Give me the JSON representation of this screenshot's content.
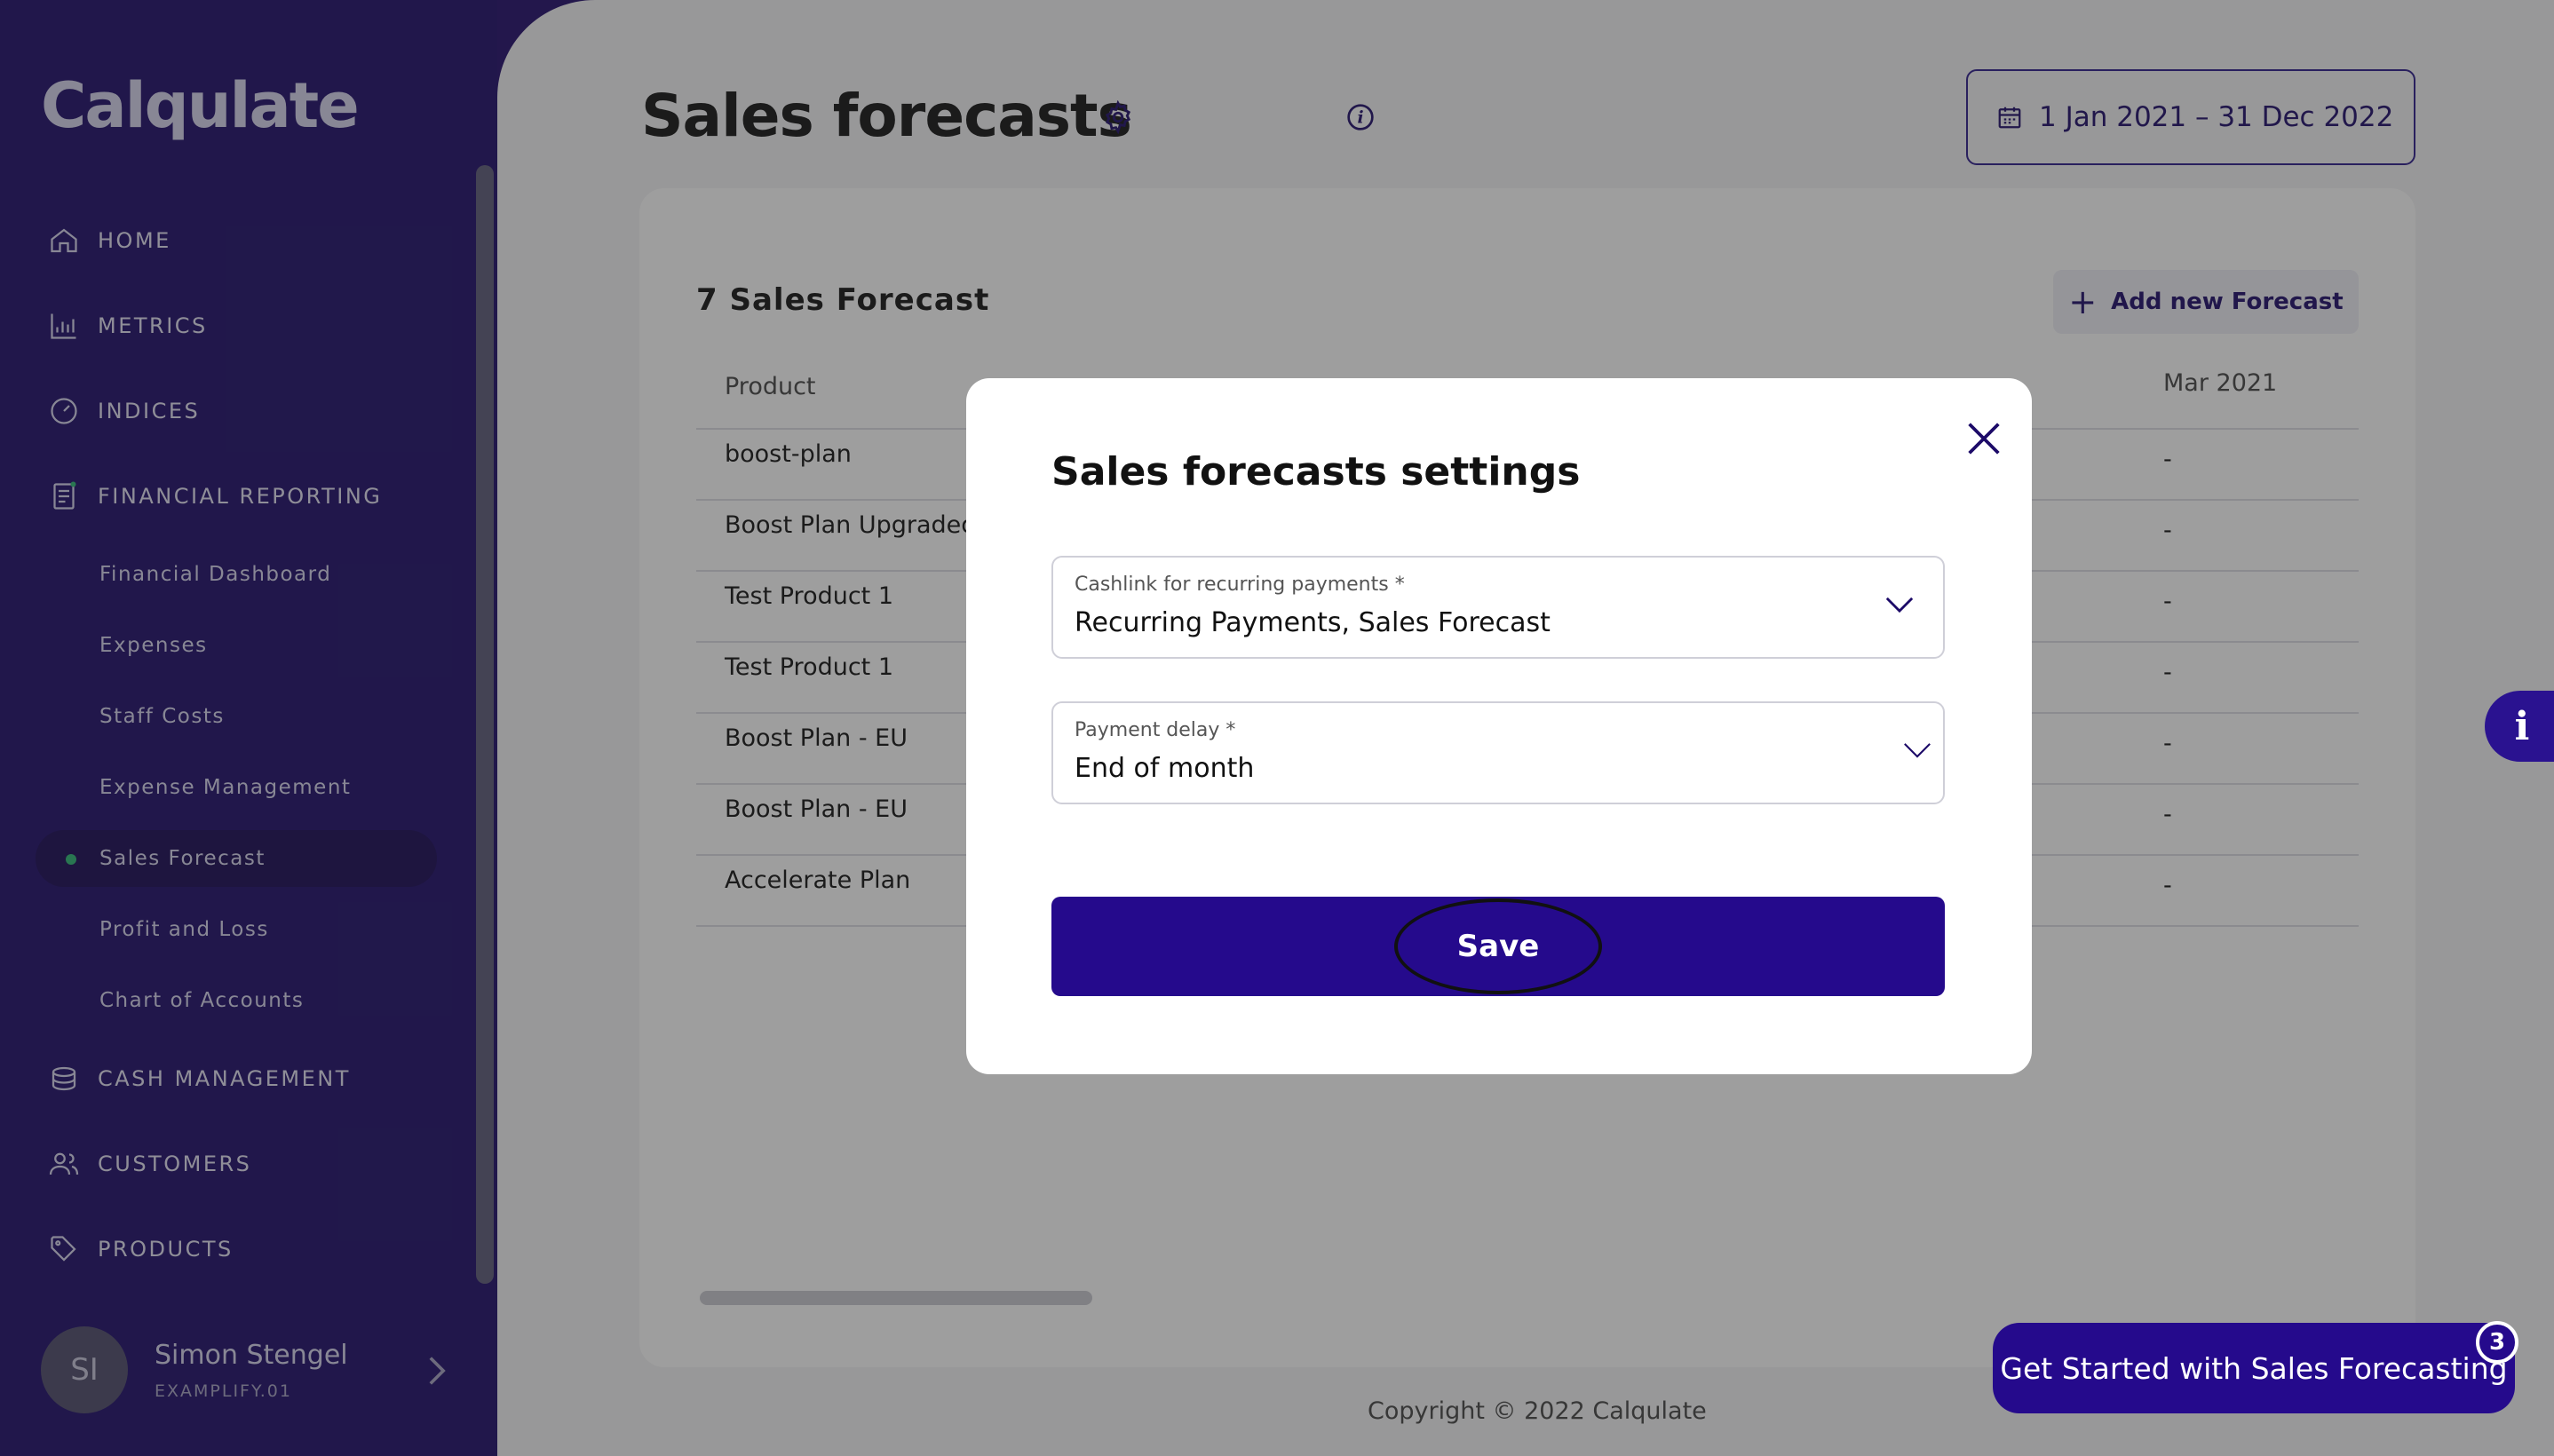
{
  "sidebar": {
    "logo": "Calqulate",
    "nav": [
      {
        "label": "HOME",
        "icon": "home-icon"
      },
      {
        "label": "METRICS",
        "icon": "bar-chart-icon"
      },
      {
        "label": "INDICES",
        "icon": "gauge-icon"
      },
      {
        "label": "FINANCIAL REPORTING",
        "icon": "report-icon"
      }
    ],
    "sub_items": [
      {
        "label": "Financial Dashboard"
      },
      {
        "label": "Expenses"
      },
      {
        "label": "Staff Costs"
      },
      {
        "label": "Expense Management"
      },
      {
        "label": "Sales Forecast",
        "active": true
      },
      {
        "label": "Profit and Loss"
      },
      {
        "label": "Chart of Accounts"
      }
    ],
    "nav_bottom": [
      {
        "label": "CASH MANAGEMENT",
        "icon": "coins-icon"
      },
      {
        "label": "CUSTOMERS",
        "icon": "users-icon"
      },
      {
        "label": "PRODUCTS",
        "icon": "tag-icon"
      }
    ],
    "user": {
      "initials": "SI",
      "name": "Simon Stengel",
      "org": "EXAMPLIFY.01"
    }
  },
  "header": {
    "title": "Sales forecasts",
    "date_range": "1 Jan 2021 – 31 Dec 2022"
  },
  "card": {
    "title": "7 Sales Forecast",
    "add_label": "Add new Forecast",
    "col_product": "Product",
    "col_mar": "Mar 2021",
    "rows": [
      {
        "product": "boost-plan",
        "mar": "-"
      },
      {
        "product": "Boost Plan Upgraded",
        "mar": "-"
      },
      {
        "product": "Test Product 1",
        "mar": "-"
      },
      {
        "product": "Test Product 1",
        "mar": "-"
      },
      {
        "product": "Boost Plan - EU",
        "mar": "-"
      },
      {
        "product": "Boost Plan - EU",
        "mar": "-"
      },
      {
        "product": "Accelerate Plan",
        "mar": "-"
      }
    ]
  },
  "footer": {
    "copyright": "Copyright © 2022 Calqulate"
  },
  "modal": {
    "title": "Sales forecasts settings",
    "cashlink_label": "Cashlink for recurring payments *",
    "cashlink_value": "Recurring Payments, Sales Forecast",
    "delay_label": "Payment delay *",
    "delay_value": "End of month",
    "save_label": "Save"
  },
  "cta": {
    "label": "Get Started with Sales Forecasting",
    "badge": "3"
  },
  "side_info": {
    "label": "i"
  },
  "colors": {
    "brand": "#1c0a68",
    "accent": "#250a8c",
    "active_dot": "#2bb673"
  }
}
